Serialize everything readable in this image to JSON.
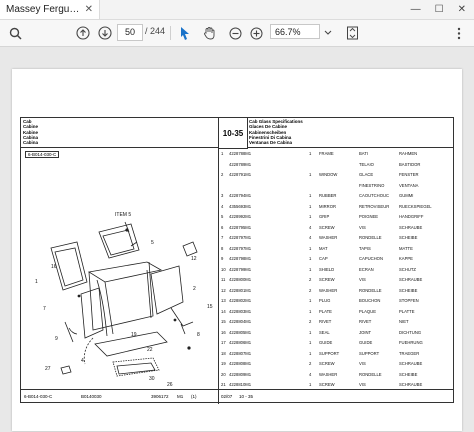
{
  "app": {
    "tab_title": "Massey Ferguson ...",
    "tab_close": "✕"
  },
  "window": {
    "minimize": "—",
    "maximize": "☐",
    "close": "✕"
  },
  "toolbar": {
    "page_current": "50",
    "page_total": "/ 244",
    "zoom": "66.7%"
  },
  "doc": {
    "hdr_left": [
      "Cab",
      "Cabine",
      "Kabine",
      "Cabina",
      "Cabina"
    ],
    "hdr_num": "10-35",
    "hdr_right": [
      "Cab Glass Specifications",
      "Glaces De Cabine",
      "Kabinenscheiben",
      "Finestrini Di Cabina",
      "Ventanas De Cabina"
    ],
    "diagram_code": "6-B014-030-C",
    "item_label": "ITEM 5",
    "parts": [
      [
        "1",
        "4228788M1",
        "",
        "1",
        "FRAME",
        "BATI",
        "RAHMEN"
      ],
      [
        "",
        "4228789M1",
        "",
        "",
        "",
        "TELAIO",
        "BASTIDOR"
      ],
      [
        "2",
        "4228791M1",
        "",
        "1",
        "WINDOW",
        "GLACE",
        "FENSTER"
      ],
      [
        "",
        "",
        "",
        "",
        "",
        "FINESTRINO",
        "VENTANA"
      ],
      [
        "3",
        "4228794M1",
        "",
        "1",
        "RUBBER",
        "CAOUTCHOUC",
        "GUMMI"
      ],
      [
        "4",
        "4355693M1",
        "",
        "1",
        "MIRROR",
        "RETROVISEUR",
        "RUECKSPIEGEL"
      ],
      [
        "5",
        "4228992M1",
        "",
        "1",
        "GRIP",
        "POIGNEE",
        "HANDGRIFF"
      ],
      [
        "6",
        "4228795M1",
        "",
        "4",
        "SCREW",
        "VIS",
        "SCHRAUBE"
      ],
      [
        "7",
        "4228797M1",
        "",
        "4",
        "WASHER",
        "RONDELLE",
        "SCHEIBE"
      ],
      [
        "8",
        "4228797M1",
        "",
        "1",
        "MAT",
        "TAPIS",
        "MATTE"
      ],
      [
        "9",
        "4228798M1",
        "",
        "1",
        "CAP",
        "CAPUCHON",
        "KAPPE"
      ],
      [
        "10",
        "4228799M1",
        "",
        "1",
        "SHIELD",
        "ECRAN",
        "SCHUTZ"
      ],
      [
        "11",
        "4228800M1",
        "",
        "2",
        "SCREW",
        "VIS",
        "SCHRAUBE"
      ],
      [
        "12",
        "4228801M1",
        "",
        "2",
        "WASHER",
        "RONDELLE",
        "SCHEIBE"
      ],
      [
        "13",
        "4228802M1",
        "",
        "1",
        "PLUG",
        "BOUCHON",
        "STOPFEN"
      ],
      [
        "14",
        "4228803M1",
        "",
        "1",
        "PLATE",
        "PLAQUE",
        "PLATTE"
      ],
      [
        "15",
        "4228804M1",
        "",
        "2",
        "RIVET",
        "RIVET",
        "NIET"
      ],
      [
        "16",
        "4228805M1",
        "",
        "1",
        "SEAL",
        "JOINT",
        "DICHTUNG"
      ],
      [
        "17",
        "4228806M1",
        "",
        "1",
        "GUIDE",
        "GUIDE",
        "FUEHRUNG"
      ],
      [
        "18",
        "4228807M1",
        "",
        "1",
        "SUPPORT",
        "SUPPORT",
        "TRAEGER"
      ],
      [
        "19",
        "4228808M1",
        "",
        "2",
        "SCREW",
        "VIS",
        "SCHRAUBE"
      ],
      [
        "20",
        "4228809M1",
        "",
        "4",
        "WASHER",
        "RONDELLE",
        "SCHEIBE"
      ],
      [
        "21",
        "4228810M1",
        "",
        "1",
        "SCREW",
        "VIS",
        "SCHRAUBE"
      ]
    ],
    "footer": [
      "6-B014-030-C",
      "B0140030",
      "3906172",
      "M1",
      "(1)",
      "02/07",
      "10 - 35"
    ]
  }
}
